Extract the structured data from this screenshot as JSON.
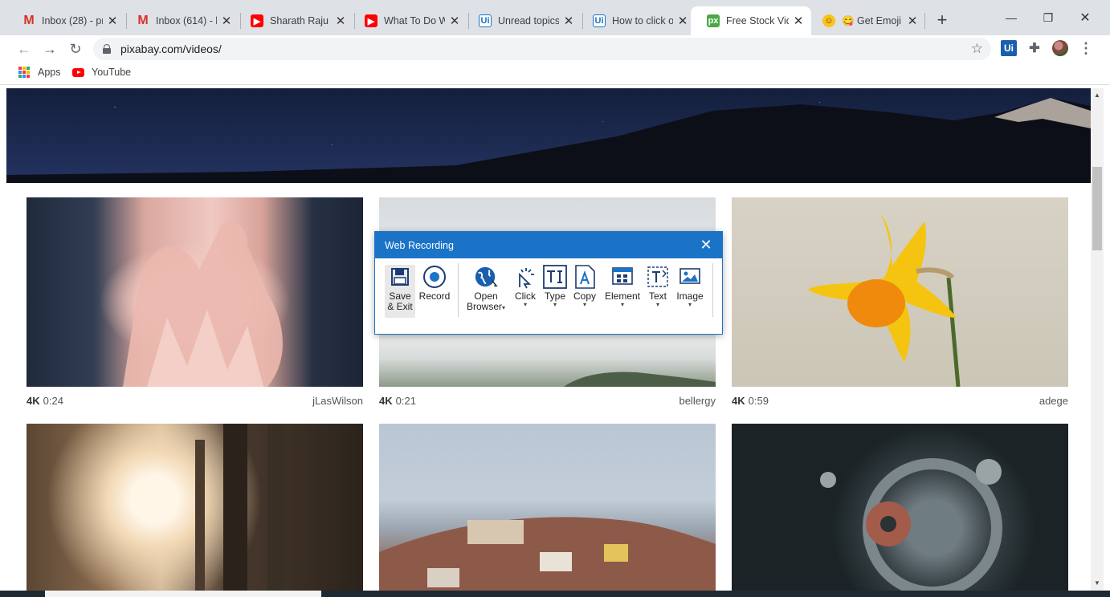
{
  "tabs": [
    {
      "title": "Inbox (28) - pr",
      "icon": "gmail-icon",
      "fav": "M"
    },
    {
      "title": "Inbox (614) - k",
      "icon": "gmail-icon",
      "fav": "M"
    },
    {
      "title": "Sharath Raju -",
      "icon": "youtube-icon",
      "fav": "▶"
    },
    {
      "title": "What To Do W",
      "icon": "youtube-icon",
      "fav": "▶"
    },
    {
      "title": "Unread topics",
      "icon": "uipath-icon",
      "fav": "Ui"
    },
    {
      "title": "How to click o",
      "icon": "uipath-icon",
      "fav": "Ui"
    },
    {
      "title": "Free Stock Vid",
      "icon": "pixabay-icon",
      "fav": "px"
    },
    {
      "title": "😋 Get Emoji",
      "icon": "emoji-icon",
      "fav": "☺"
    }
  ],
  "toolbar": {
    "url": "pixabay.com/videos/",
    "back": "←",
    "forward": "→",
    "reload": "↻",
    "star": "☆",
    "ext_ui": "Ui",
    "ext_puzzle": "✚",
    "menu": "⋮"
  },
  "window": {
    "minimize": "—",
    "restore": "❐",
    "close": "✕",
    "new_tab": "+",
    "tab_close": "✕"
  },
  "bookmarks": [
    {
      "label": "Apps"
    },
    {
      "label": "YouTube"
    }
  ],
  "videos": [
    {
      "quality": "4K",
      "duration": "0:24",
      "author": "jLasWilson"
    },
    {
      "quality": "4K",
      "duration": "0:21",
      "author": "bellergy"
    },
    {
      "quality": "4K",
      "duration": "0:59",
      "author": "adege"
    }
  ],
  "dialog": {
    "title": "Web Recording",
    "close": "✕",
    "buttons": {
      "save_line1": "Save",
      "save_line2": "& Exit",
      "record": "Record",
      "open_line1": "Open",
      "open_line2": "Browser",
      "click": "Click",
      "type": "Type",
      "copy": "Copy",
      "element": "Element",
      "text": "Text",
      "image": "Image"
    },
    "caret": "▾"
  },
  "colors": {
    "accent": "#1a73c7",
    "tab_bar": "#dee1e6",
    "gmail": "#d93025",
    "youtube": "#ff0000"
  }
}
